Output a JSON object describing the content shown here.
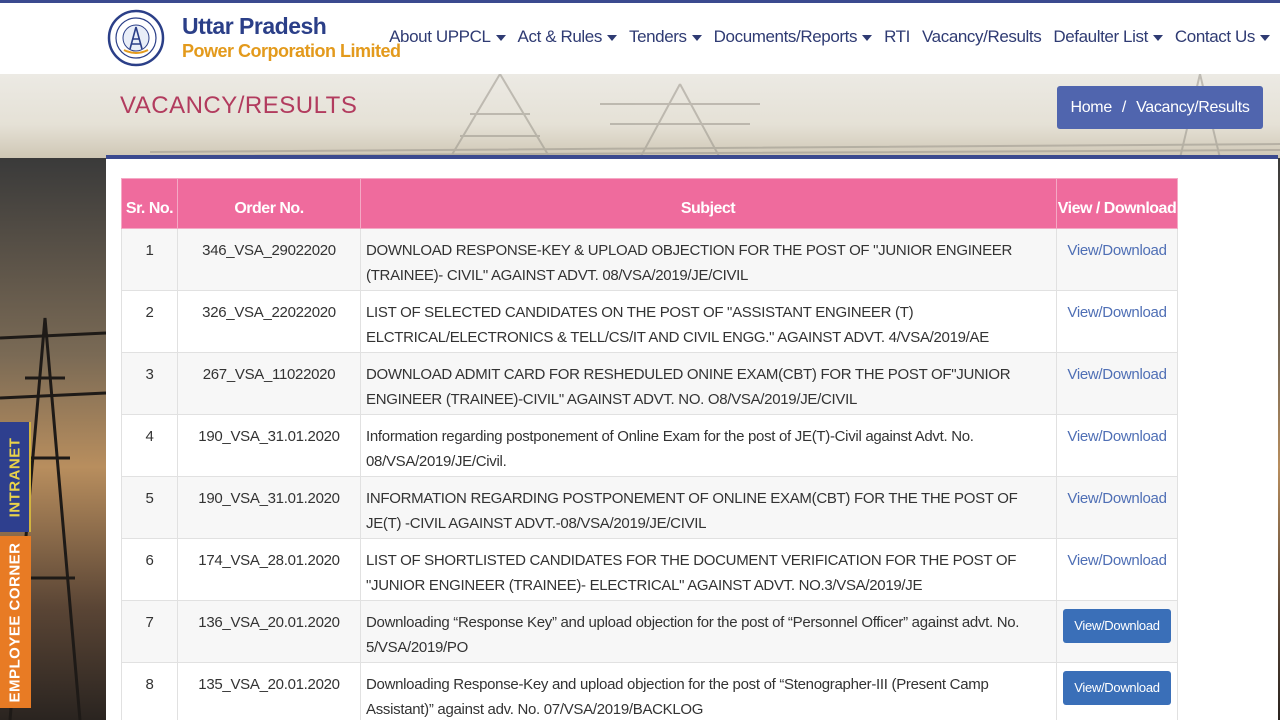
{
  "header": {
    "brand_line1": "Uttar Pradesh",
    "brand_line2": "Power Corporation Limited",
    "logo_icon": "uppcl-seal-logo",
    "nav": [
      {
        "label": "About UPPCL",
        "dropdown": true
      },
      {
        "label": "Act & Rules",
        "dropdown": true
      },
      {
        "label": "Tenders",
        "dropdown": true
      },
      {
        "label": "Documents/Reports",
        "dropdown": true
      },
      {
        "label": "RTI",
        "dropdown": false
      },
      {
        "label": "Vacancy/Results",
        "dropdown": false
      },
      {
        "label": "Defaulter List",
        "dropdown": true
      },
      {
        "label": "Contact Us",
        "dropdown": true
      }
    ]
  },
  "banner": {
    "title": "VACANCY/RESULTS",
    "breadcrumb": {
      "home": "Home",
      "separator": "/",
      "current": "Vacancy/Results"
    }
  },
  "sidetabs": {
    "intranet": "INTRANET",
    "employee": "EMPLOYEE CORNER"
  },
  "table": {
    "headers": {
      "sr": "Sr. No.",
      "order": "Order No.",
      "subject": "Subject",
      "view": "View / Download"
    },
    "rows": [
      {
        "sr": "1",
        "order": "346_VSA_29022020",
        "subject": "DOWNLOAD RESPONSE-KEY & UPLOAD OBJECTION FOR THE POST OF \"JUNIOR ENGINEER (TRAINEE)- CIVIL\" AGAINST ADVT. 08/VSA/2019/JE/CIVIL",
        "view": "View/Download",
        "style": "link"
      },
      {
        "sr": "2",
        "order": "326_VSA_22022020",
        "subject": "LIST OF SELECTED CANDIDATES ON THE POST OF  \"ASSISTANT ENGINEER (T) ELCTRICAL/ELECTRONICS & TELL/CS/IT AND CIVIL ENGG.\"  AGAINST ADVT. 4/VSA/2019/AE",
        "view": "View/Download",
        "style": "link"
      },
      {
        "sr": "3",
        "order": "267_VSA_11022020",
        "subject": "DOWNLOAD ADMIT CARD FOR RESHEDULED ONINE EXAM(CBT) FOR THE POST OF\"JUNIOR ENGINEER (TRAINEE)-CIVIL\" AGAINST ADVT. NO. O8/VSA/2019/JE/CIVIL",
        "view": "View/Download",
        "style": "link"
      },
      {
        "sr": "4",
        "order": "190_VSA_31.01.2020",
        "subject": "Information regarding postponement of Online Exam for the post of JE(T)-Civil against Advt. No. 08/VSA/2019/JE/Civil.",
        "view": "View/Download",
        "style": "link"
      },
      {
        "sr": "5",
        "order": "190_VSA_31.01.2020",
        "subject": "INFORMATION REGARDING POSTPONEMENT OF ONLINE EXAM(CBT) FOR THE THE POST OF JE(T) -CIVIL AGAINST ADVT.-08/VSA/2019/JE/CIVIL",
        "view": "View/Download",
        "style": "link"
      },
      {
        "sr": "6",
        "order": "174_VSA_28.01.2020",
        "subject": "LIST OF SHORTLISTED  CANDIDATES FOR THE  DOCUMENT VERIFICATION FOR THE POST OF \"JUNIOR ENGINEER (TRAINEE)- ELECTRICAL\" AGAINST ADVT.  NO.3/VSA/2019/JE",
        "view": "View/Download",
        "style": "link"
      },
      {
        "sr": "7",
        "order": "136_VSA_20.01.2020",
        "subject": "Downloading “Response Key” and upload objection for the post of “Personnel Officer” against advt. No. 5/VSA/2019/PO",
        "view": "View/Download",
        "style": "button"
      },
      {
        "sr": "8",
        "order": "135_VSA_20.01.2020",
        "subject": "Downloading Response-Key and upload objection for the post of “Stenographer-III (Present Camp Assistant)” against adv. No. 07/VSA/2019/BACKLOG",
        "view": "View/Download",
        "style": "button"
      }
    ]
  },
  "colors": {
    "primary": "#3b4a8f",
    "accent": "#e39a1c",
    "table_header": "#ef6b9d",
    "title": "#b23b5e"
  }
}
